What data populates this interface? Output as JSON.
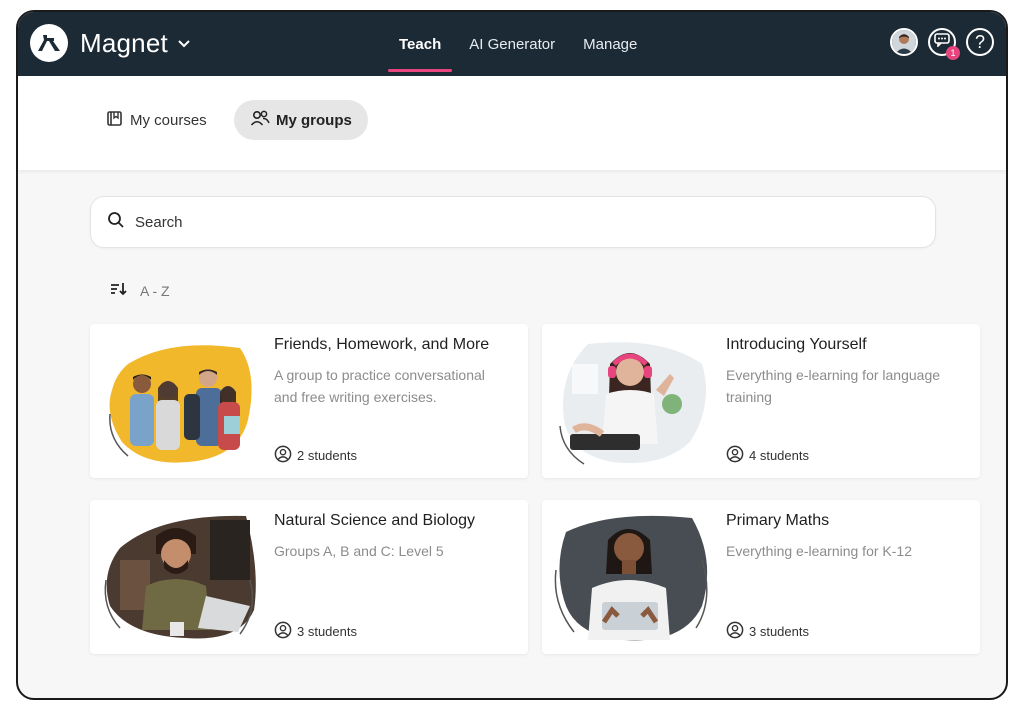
{
  "app": {
    "name": "Magnet"
  },
  "nav": {
    "tabs": [
      {
        "label": "Teach",
        "active": true
      },
      {
        "label": "AI Generator",
        "active": false
      },
      {
        "label": "Manage",
        "active": false
      }
    ],
    "notifications": "1",
    "help": "?"
  },
  "subnav": {
    "items": [
      {
        "label": "My courses",
        "active": false
      },
      {
        "label": "My groups",
        "active": true
      }
    ]
  },
  "search": {
    "placeholder": "Search"
  },
  "sort": {
    "label": "A - Z"
  },
  "groups": [
    {
      "title": "Friends, Homework, and More",
      "description": "A group to practice conversational and free writing exercises.",
      "students": "2 students"
    },
    {
      "title": "Introducing Yourself",
      "description": "Everything e-learning for language training",
      "students": "4 students"
    },
    {
      "title": "Natural Science and Biology",
      "description": "Groups A, B and C: Level 5",
      "students": "3 students"
    },
    {
      "title": "Primary Maths",
      "description": "Everything e-learning for K-12",
      "students": "3 students"
    }
  ],
  "colors": {
    "topbar": "#1c2a36",
    "accent": "#e8457e",
    "card_bg": "#ffffff",
    "page_bg": "#f7f7f7"
  },
  "icons": [
    "magnet-logo-icon",
    "chevron-down-icon",
    "avatar",
    "chat-icon",
    "help-icon",
    "book-icon",
    "users-icon",
    "search-icon",
    "sort-icon",
    "user-circle-icon"
  ]
}
